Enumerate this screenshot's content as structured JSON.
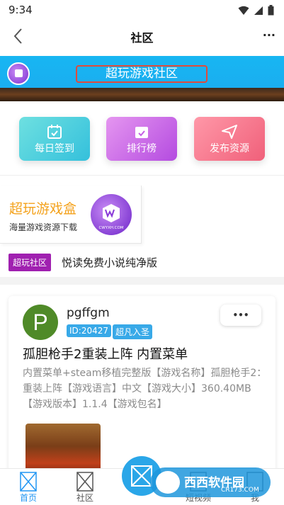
{
  "status_bar": {
    "time": "9:34"
  },
  "title_bar": {
    "title": "社区",
    "more": "..."
  },
  "banner": {
    "title": "超玩游戏社区"
  },
  "actions": [
    {
      "label": "每日签到",
      "icon": "calendar-check-icon"
    },
    {
      "label": "排行榜",
      "icon": "ranking-icon"
    },
    {
      "label": "发布资源",
      "icon": "paper-plane-icon"
    }
  ],
  "promo": {
    "title": "超玩游戏盒",
    "subtitle": "海量游戏资源下载",
    "logo_text": "CWYXH.COM"
  },
  "news": {
    "tag": "超玩社区",
    "text": "悦读免费小说纯净版"
  },
  "post": {
    "avatar_letter": "P",
    "username": "pgffgm",
    "id_badge": "ID:20427",
    "rank_badge": "超凡入圣",
    "more": "•••",
    "title": "孤胆枪手2重装上阵 内置菜单",
    "body": "内置菜单+steam移植完整版【游戏名称】孤胆枪手2：重装上阵【游戏语言】中文【游戏大小】360.40MB【游戏版本】1.1.4【游戏包名】"
  },
  "bottom_nav": [
    {
      "label": "首页"
    },
    {
      "label": "社区"
    },
    {
      "label": "短视频"
    },
    {
      "label": "我"
    }
  ],
  "watermark": {
    "text": "西西软件园",
    "sub": "CR173.COM"
  },
  "colors": {
    "accent": "#2196f3",
    "banner": "#1aaef0",
    "promo_title": "#f4a21c",
    "tag": "#a020b0"
  }
}
